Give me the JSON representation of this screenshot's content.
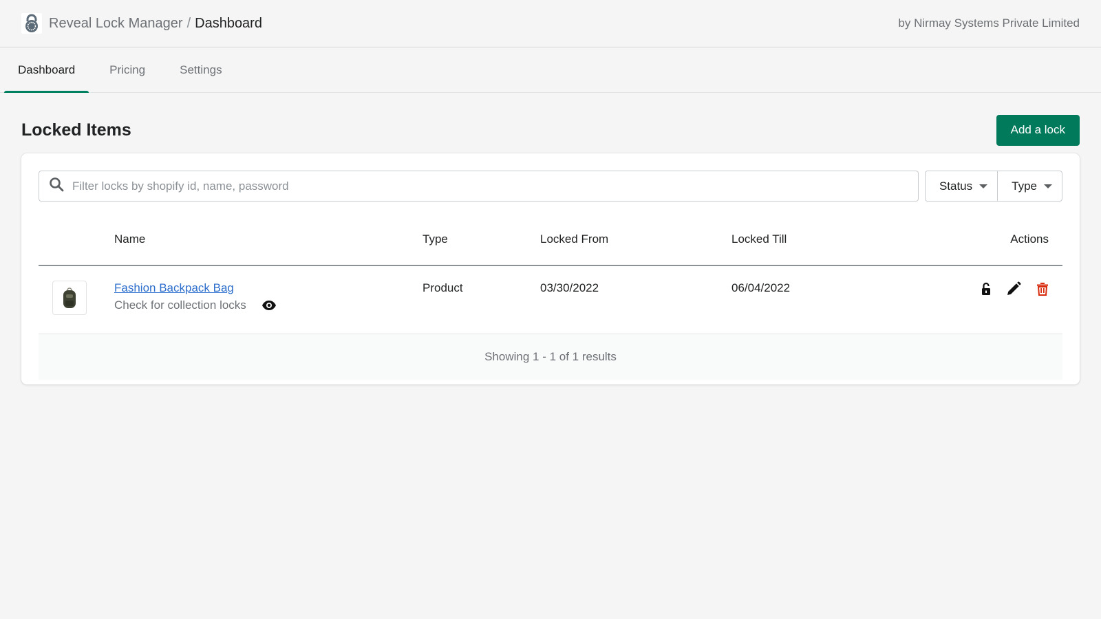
{
  "header": {
    "app_name": "Reveal Lock Manager",
    "separator": "/",
    "current_page": "Dashboard",
    "vendor": "by Nirmay Systems Private Limited"
  },
  "tabs": [
    {
      "label": "Dashboard",
      "active": true
    },
    {
      "label": "Pricing",
      "active": false
    },
    {
      "label": "Settings",
      "active": false
    }
  ],
  "page": {
    "title": "Locked Items",
    "add_button": "Add a lock"
  },
  "filters": {
    "search_placeholder": "Filter locks by shopify id, name, password",
    "search_value": "",
    "status_label": "Status",
    "type_label": "Type"
  },
  "table": {
    "columns": [
      "",
      "Name",
      "Type",
      "Locked From",
      "Locked Till",
      "Actions"
    ],
    "rows": [
      {
        "name": "Fashion Backpack Bag",
        "subtext": "Check for collection locks",
        "type": "Product",
        "locked_from": "03/30/2022",
        "locked_till": "06/04/2022"
      }
    ],
    "footer": "Showing 1 - 1 of 1 results"
  },
  "colors": {
    "primary": "#007a5a",
    "link": "#2c6ecb",
    "danger": "#d72c0d"
  }
}
